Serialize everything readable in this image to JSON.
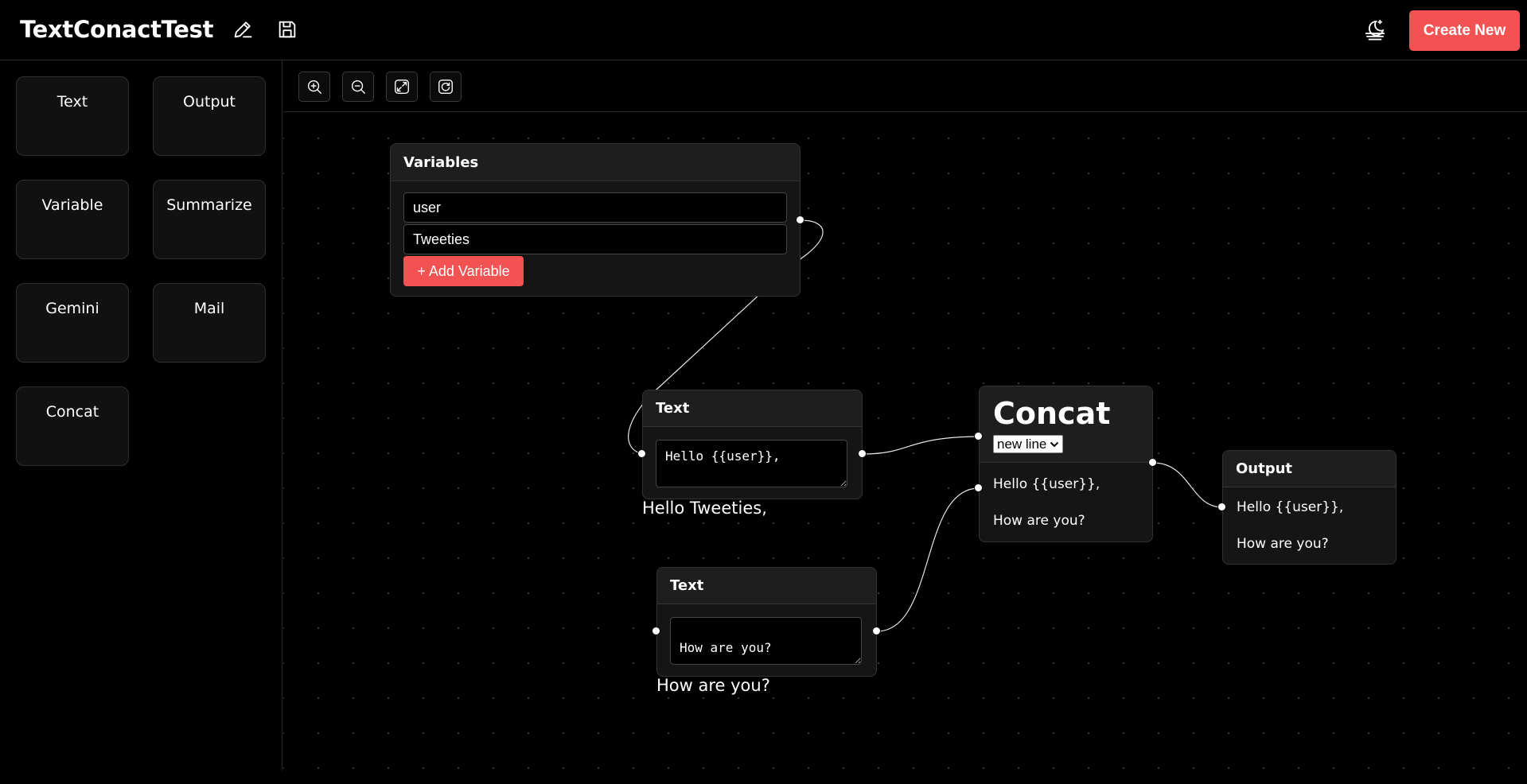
{
  "app": {
    "title": "TextConactTest",
    "create_new_label": "Create New",
    "accent_color": "#f25252",
    "header_icons": [
      "pencil-icon",
      "save-icon",
      "theme-toggle-icon"
    ]
  },
  "palette": {
    "items": [
      "Text",
      "Output",
      "Variable",
      "Summarize",
      "Gemini",
      "Mail",
      "Concat"
    ]
  },
  "toolbar": {
    "icons": [
      "zoom-in-icon",
      "zoom-out-icon",
      "fit-view-icon",
      "reset-view-icon"
    ]
  },
  "nodes": {
    "variables": {
      "title": "Variables",
      "values": [
        "user",
        "Tweeties"
      ],
      "add_label": "+ Add Variable"
    },
    "text1": {
      "title": "Text",
      "value": "Hello {{user}},",
      "preview": "Hello Tweeties,"
    },
    "text2": {
      "title": "Text",
      "value": "How are you?",
      "preview": "How are you?"
    },
    "concat": {
      "title": "Concat",
      "separator": "new line",
      "output": [
        "Hello {{user}},",
        "How are you?"
      ]
    },
    "output": {
      "title": "Output",
      "lines": [
        "Hello {{user}},",
        "How are you?"
      ]
    }
  }
}
